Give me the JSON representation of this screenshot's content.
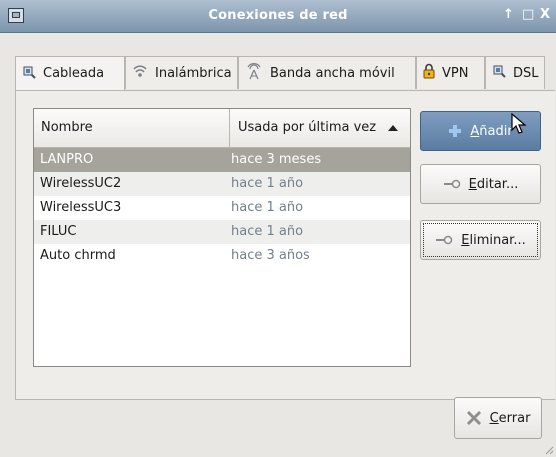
{
  "window": {
    "title": "Conexiones de red",
    "controls": {
      "keep_above": "↑",
      "maximize": "□",
      "close": "X"
    }
  },
  "tabs": [
    {
      "label": "Cableada",
      "icon": "wired-icon"
    },
    {
      "label": "Inalámbrica",
      "icon": "wireless-icon"
    },
    {
      "label": "Banda ancha móvil",
      "icon": "mobile-broadband-icon"
    },
    {
      "label": "VPN",
      "icon": "vpn-lock-icon"
    },
    {
      "label": "DSL",
      "icon": "dsl-icon"
    }
  ],
  "active_tab": "Cableada",
  "list": {
    "columns": {
      "name": "Nombre",
      "last_used": "Usada por última vez"
    },
    "sort": "last_used-ascending",
    "rows": [
      {
        "name": "LANPRO",
        "last_used": "hace 3 meses",
        "selected": true
      },
      {
        "name": "WirelessUC2",
        "last_used": "hace 1 año"
      },
      {
        "name": "WirelessUC3",
        "last_used": "hace 1 año"
      },
      {
        "name": "FILUC",
        "last_used": "hace 1 año"
      },
      {
        "name": "Auto chrmd",
        "last_used": "hace 3 años"
      }
    ]
  },
  "buttons": {
    "add": {
      "mnemonic": "A",
      "rest": "ñadir",
      "icon": "plus-icon"
    },
    "edit": {
      "mnemonic": "E",
      "rest": "ditar...",
      "icon": "key-icon"
    },
    "delete": {
      "mnemonic": "E",
      "rest": "liminar...",
      "icon": "key-icon"
    },
    "close": {
      "mnemonic": "C",
      "rest": "errar",
      "icon": "close-x-icon"
    }
  },
  "colors": {
    "accent": "#5b7ca2",
    "selection": "#a6a39c",
    "titlebar": "#7d95ad"
  }
}
